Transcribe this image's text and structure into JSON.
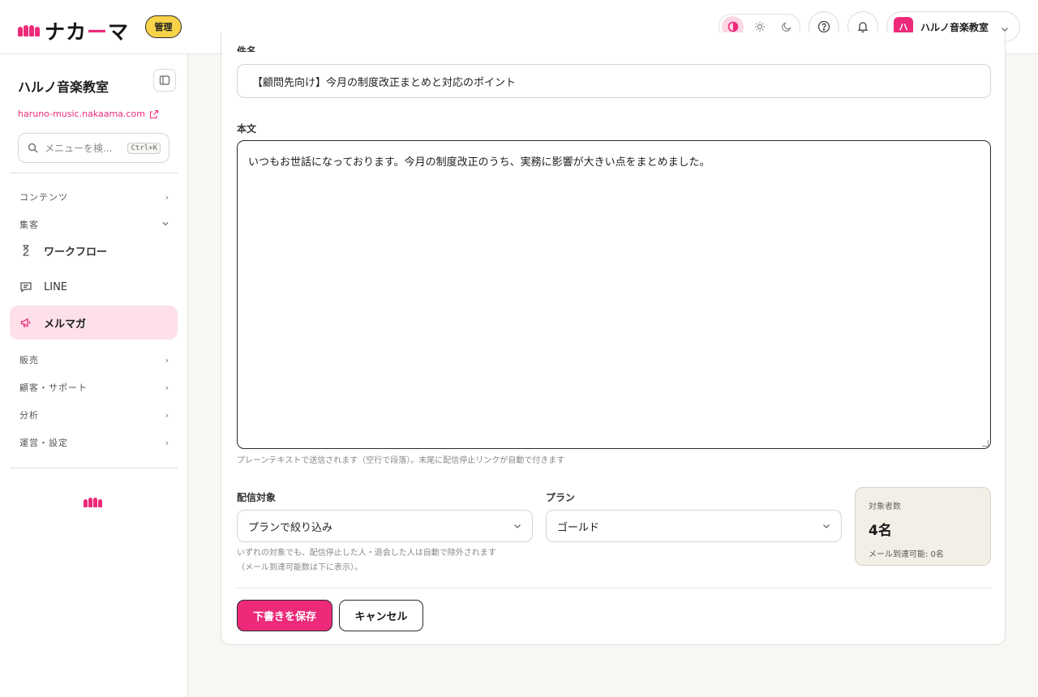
{
  "app": {
    "logo_text_a": "ナカ",
    "logo_text_dash": "ー",
    "logo_text_b": "マ",
    "admin_badge": "管理"
  },
  "header": {
    "theme_options": [
      "contrast-icon",
      "sun-icon",
      "moon-icon"
    ],
    "account_avatar": "ハ",
    "account_name": "ハルノ音楽教室"
  },
  "sidebar": {
    "org_name": "ハルノ音楽教室",
    "org_url": "haruno-music.nakaama.com",
    "search_placeholder": "メニューを検...",
    "search_shortcut": "Ctrl+K",
    "group_contents": "コンテンツ",
    "group_marketing": "集客",
    "item_workflow": "ワークフロー",
    "item_line": "LINE",
    "item_newsletter": "メルマガ",
    "group_sales": "販売",
    "group_customers": "顧客・サポート",
    "group_analytics": "分析",
    "group_operations": "運営・設定"
  },
  "form": {
    "subject_label": "件名",
    "subject_value": "【顧問先向け】今月の制度改正まとめと対応のポイント",
    "body_label": "本文",
    "body_value": "いつもお世話になっております。今月の制度改正のうち、実務に影響が大きい点をまとめました。",
    "body_hint": "プレーンテキストで送信されます（空行で段落）。末尾に配信停止リンクが自動で付きます",
    "target_label": "配信対象",
    "target_value": "プランで絞り込み",
    "target_hint_1": "いずれの対象でも、配信停止した人・退会した人は自動で除外されます",
    "target_hint_2": "（メール到達可能数は下に表示）。",
    "plan_label": "プラン",
    "plan_value": "ゴールド",
    "count_title": "対象者数",
    "count_value": "4名",
    "count_sub": "メール到達可能: 0名",
    "save_button": "下書きを保存",
    "cancel_button": "キャンセル"
  },
  "colors": {
    "accent": "#ec2a79",
    "badge": "#f7d34a",
    "active_bg": "#fde0ea",
    "count_bg": "#f3efe7"
  }
}
